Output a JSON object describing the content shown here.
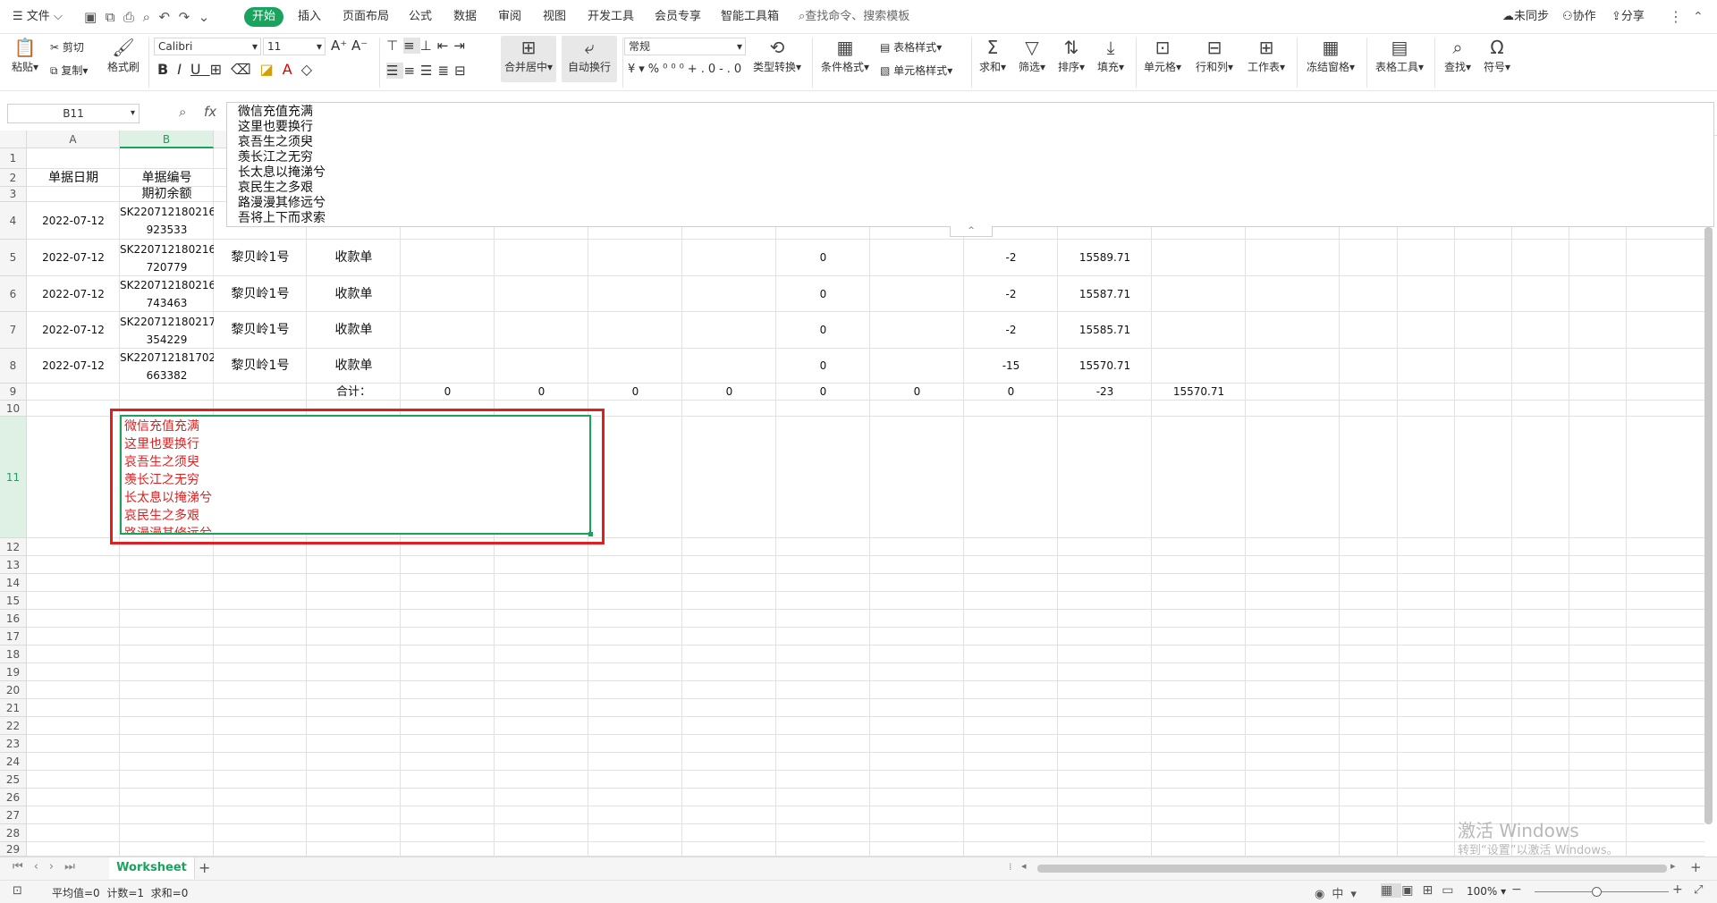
{
  "menu": {
    "file": "文件",
    "tabs": [
      "开始",
      "插入",
      "页面布局",
      "公式",
      "数据",
      "审阅",
      "视图",
      "开发工具",
      "会员专享",
      "智能工具箱"
    ],
    "search_placeholder": "查找命令、搜索模板",
    "sync": "未同步",
    "collab": "协作",
    "share": "分享"
  },
  "ribbon": {
    "paste": "粘贴",
    "cut": "剪切",
    "copy": "复制",
    "format_painter": "格式刷",
    "font_name": "Calibri",
    "font_size": "11",
    "merge_center": "合并居中",
    "wrap_text": "自动换行",
    "number_format": "常规",
    "type_convert": "类型转换",
    "cond_format": "条件格式",
    "table_style": "表格样式",
    "cell_style": "单元格样式",
    "sum": "求和",
    "filter": "筛选",
    "sort": "排序",
    "fill": "填充",
    "cell": "单元格",
    "row_col": "行和列",
    "worksheet": "工作表",
    "freeze": "冻结窗格",
    "table_tools": "表格工具",
    "find": "查找",
    "symbol": "符号"
  },
  "formula_bar": {
    "cell_ref": "B11",
    "fx": "fx",
    "lines": [
      "微信充值充满",
      "这里也要换行",
      "哀吾生之须臾",
      "羡长江之无穷",
      "长太息以掩涕兮",
      "哀民生之多艰",
      "路漫漫其修远兮",
      "吾将上下而求索"
    ]
  },
  "sheet": {
    "col_a": "A",
    "col_b": "B",
    "row_numbers": [
      "1",
      "2",
      "3",
      "4",
      "5",
      "6",
      "7",
      "8",
      "9",
      "10",
      "11",
      "12",
      "13",
      "14",
      "15",
      "16",
      "17",
      "18",
      "19",
      "20",
      "21",
      "22",
      "23",
      "24",
      "25",
      "26",
      "27",
      "28",
      "29"
    ],
    "header_date": "单据日期",
    "header_no": "单据编号",
    "opening": "期初余额",
    "rows": [
      {
        "date": "2022-07-12",
        "no1": "SK220712180216",
        "no2": "923533"
      },
      {
        "date": "2022-07-12",
        "no1": "SK220712180216",
        "no2": "720779",
        "name": "黎贝岭1号",
        "type": "收款单",
        "zero": "0",
        "delta": "-2",
        "balance": "15589.71"
      },
      {
        "date": "2022-07-12",
        "no1": "SK220712180216",
        "no2": "743463",
        "name": "黎贝岭1号",
        "type": "收款单",
        "zero": "0",
        "delta": "-2",
        "balance": "15587.71"
      },
      {
        "date": "2022-07-12",
        "no1": "SK220712180217",
        "no2": "354229",
        "name": "黎贝岭1号",
        "type": "收款单",
        "zero": "0",
        "delta": "-2",
        "balance": "15585.71"
      },
      {
        "date": "2022-07-12",
        "no1": "SK220712181702",
        "no2": "663382",
        "name": "黎贝岭1号",
        "type": "收款单",
        "zero": "0",
        "delta": "-15",
        "balance": "15570.71"
      }
    ],
    "total_label": "合计：",
    "totals": [
      "0",
      "0",
      "0",
      "0",
      "0",
      "0",
      "0",
      "-23",
      "15570.71"
    ],
    "b11_lines": [
      "微信充值充满",
      "这里也要换行",
      "哀吾生之须臾",
      "羡长江之无穷",
      "长太息以掩涕兮",
      "哀民生之多艰",
      "路漫漫其修远兮"
    ]
  },
  "sheet_tab": "Worksheet",
  "status": {
    "stats": "平均值=0  计数=1  求和=0",
    "zoom": "100%"
  },
  "watermark": {
    "line1": "激活 Windows",
    "line2": "转到“设置”以激活 Windows。"
  },
  "colors": {
    "accent": "#1aa35d",
    "annotation_red": "#e02020",
    "cell_text_red": "#e02020"
  }
}
